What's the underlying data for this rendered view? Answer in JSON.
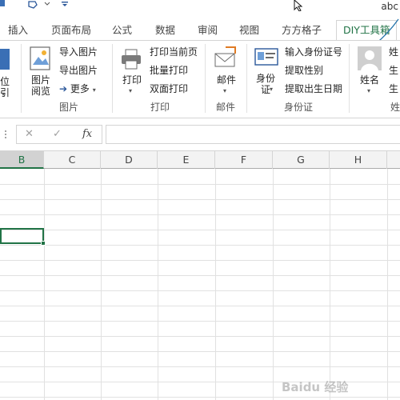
{
  "qat": {
    "corner_text": "abc"
  },
  "tabs": [
    {
      "label": "插入"
    },
    {
      "label": "页面布局"
    },
    {
      "label": "公式"
    },
    {
      "label": "数据"
    },
    {
      "label": "审阅"
    },
    {
      "label": "视图"
    },
    {
      "label": "方方格子"
    },
    {
      "label": "DIY工具箱",
      "active": true
    }
  ],
  "ribbon": {
    "partial_left_label": "位引",
    "images_group": {
      "label": "图片",
      "large_button": "图片\n阅览",
      "buttons": [
        "导入图片",
        "导出图片",
        "更多"
      ]
    },
    "print_group": {
      "label": "打印",
      "large_button": "打印",
      "buttons": [
        "打印当前页",
        "批量打印",
        "双面打印"
      ]
    },
    "mail_group": {
      "label": "邮件",
      "large_button": "邮件"
    },
    "id_group": {
      "label": "身份证",
      "large_button": "身份\n证",
      "buttons": [
        "输入身份证号",
        "提取性别",
        "提取出生日期"
      ]
    },
    "name_group": {
      "large_button": "姓名",
      "partial_buttons": [
        "姓",
        "生",
        "生"
      ],
      "partial_label": "姓"
    }
  },
  "formula_bar": {
    "cancel_symbol": "✕",
    "enter_symbol": "✓",
    "fx_label": "fx",
    "value": ""
  },
  "grid": {
    "columns": [
      "B",
      "C",
      "D",
      "E",
      "F",
      "G",
      "H"
    ],
    "selected_column": "B"
  },
  "colors": {
    "accent": "#217346",
    "header_bg": "#f3f3f3",
    "grid_line": "#e1e1e1"
  },
  "watermark": {
    "text": "Baidu 经验"
  }
}
